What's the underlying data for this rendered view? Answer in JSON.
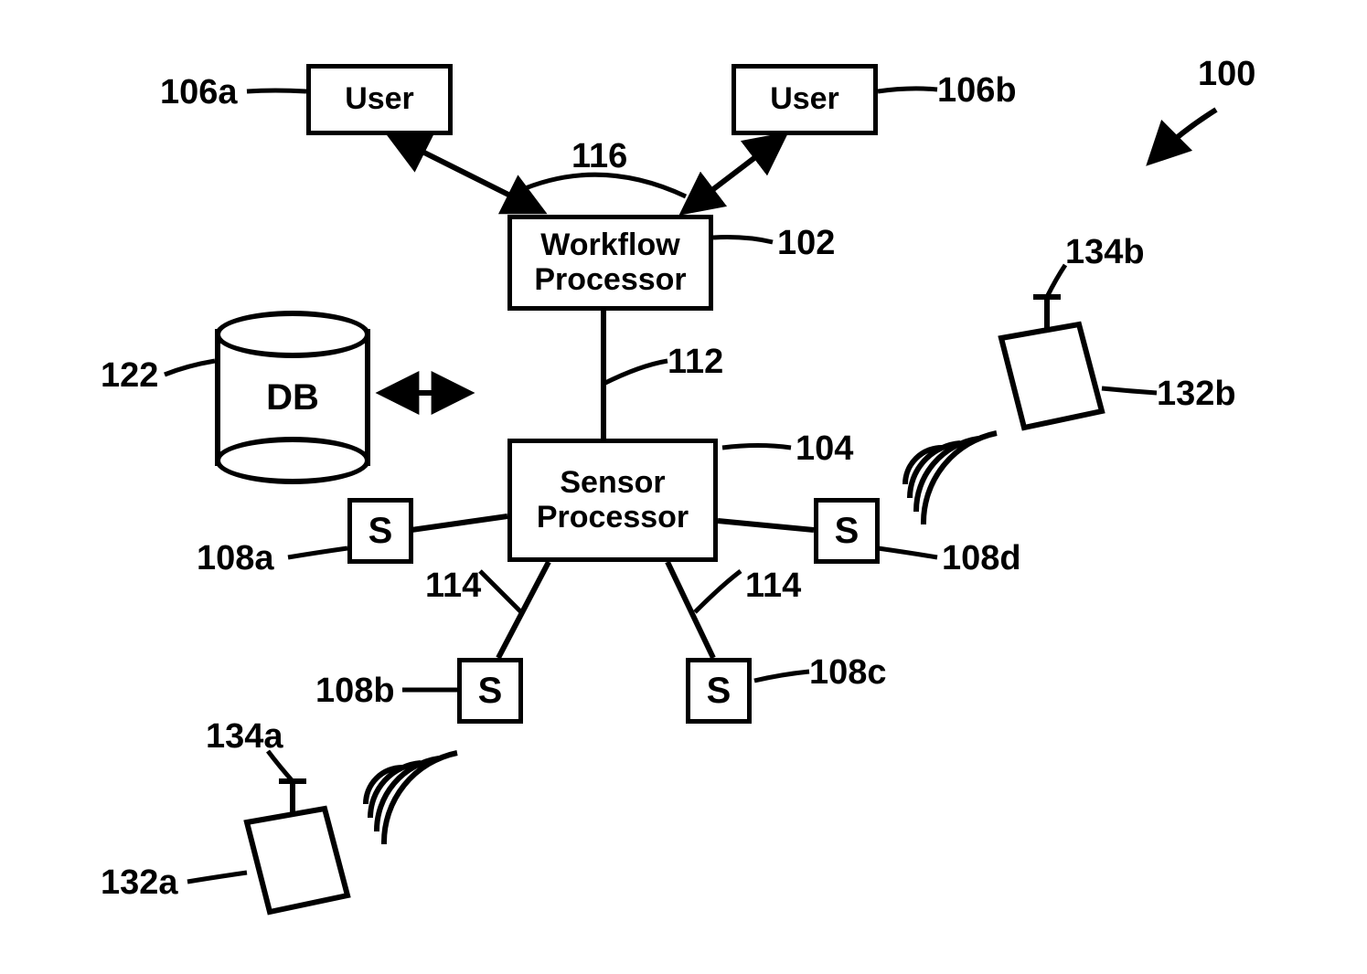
{
  "system_ref": "100",
  "users": {
    "a": {
      "label": "User",
      "ref": "106a"
    },
    "b": {
      "label": "User",
      "ref": "106b"
    }
  },
  "user_link_ref": "116",
  "workflow": {
    "label": "Workflow\nProcessor",
    "ref": "102"
  },
  "wf_sp_link_ref": "112",
  "sensor_proc": {
    "label": "Sensor\nProcessor",
    "ref": "104"
  },
  "sp_s_link_ref": "114",
  "sensors": {
    "a": {
      "label": "S",
      "ref": "108a"
    },
    "b": {
      "label": "S",
      "ref": "108b"
    },
    "c": {
      "label": "S",
      "ref": "108c"
    },
    "d": {
      "label": "S",
      "ref": "108d"
    }
  },
  "db": {
    "label": "DB",
    "ref": "122"
  },
  "tags": {
    "a": {
      "tag_ref": "132a",
      "ant_ref": "134a"
    },
    "b": {
      "tag_ref": "132b",
      "ant_ref": "134b"
    }
  }
}
